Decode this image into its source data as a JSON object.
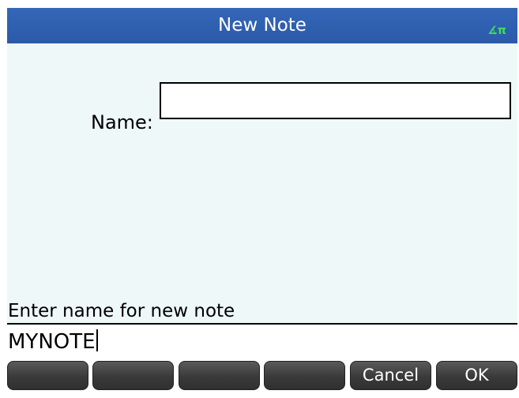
{
  "title_bar": {
    "title": "New Note",
    "angle_indicator": "∡π",
    "indicator_color": "#3fe05a",
    "background_color": "#2f60b0"
  },
  "form": {
    "name_label": "Name:",
    "name_value": ""
  },
  "hint": "Enter name for new note",
  "command_line": {
    "text": "MYNOTE"
  },
  "softkeys": [
    {
      "label": ""
    },
    {
      "label": ""
    },
    {
      "label": ""
    },
    {
      "label": ""
    },
    {
      "label": "Cancel"
    },
    {
      "label": "OK"
    }
  ]
}
